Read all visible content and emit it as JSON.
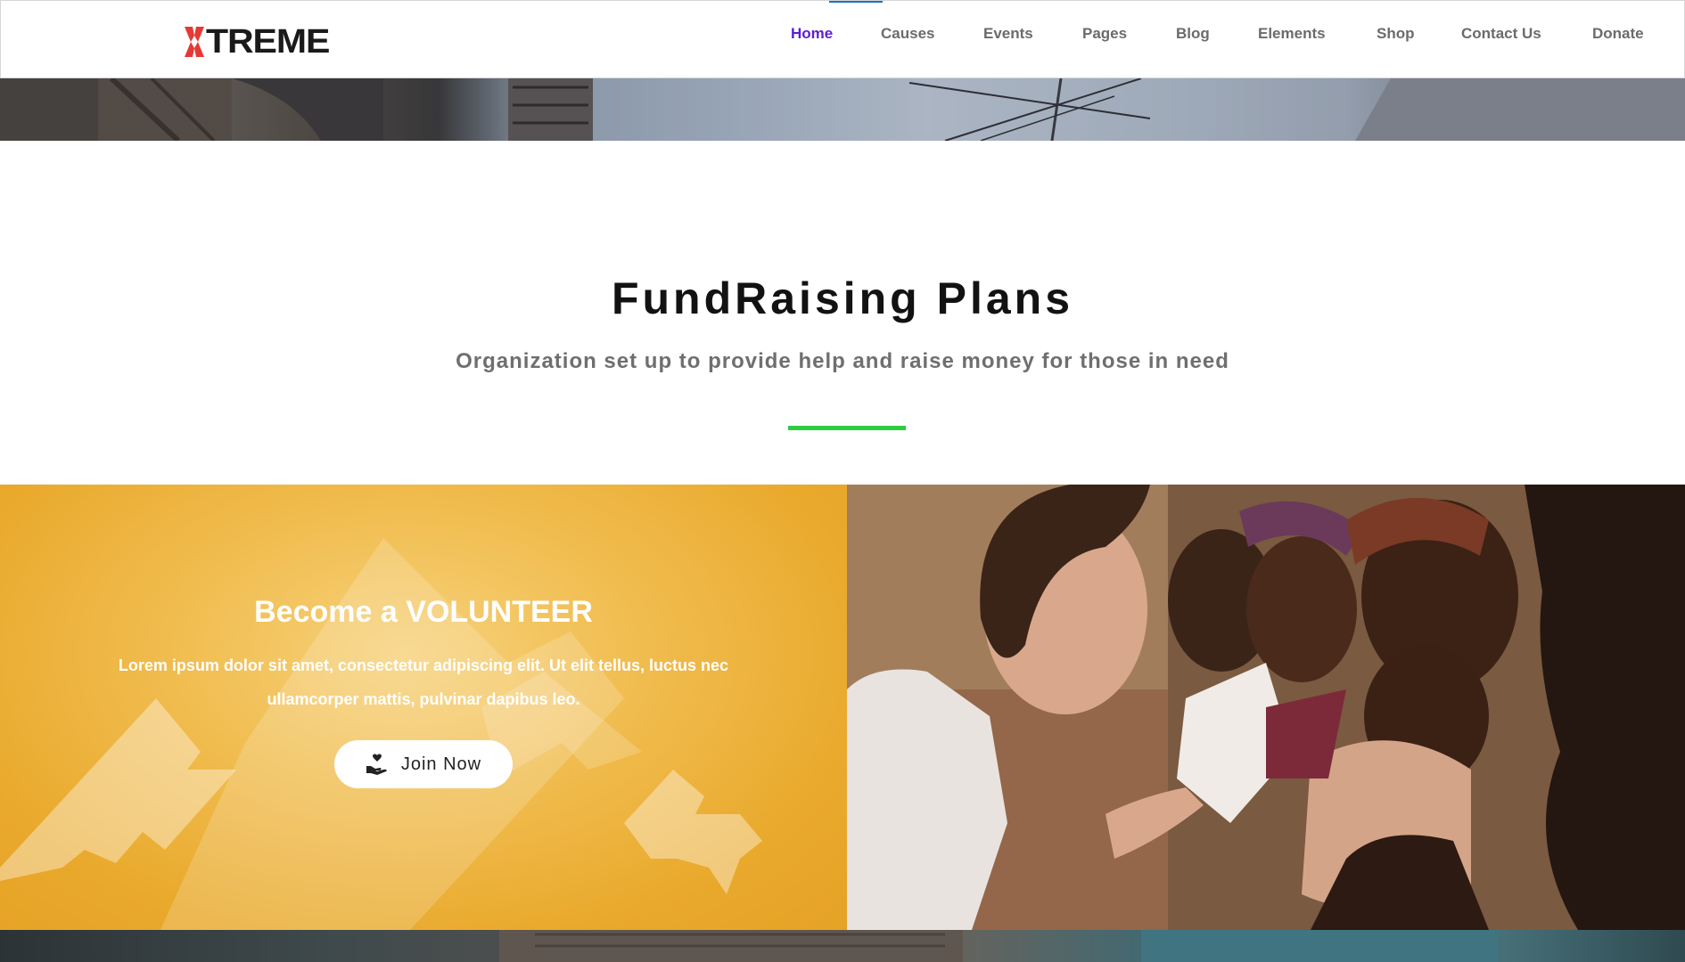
{
  "brand": {
    "logo_text": "XTREME",
    "logo_accent": "X",
    "logo_rest": "TREME",
    "accent_color": "#e53935"
  },
  "nav": {
    "items": [
      {
        "label": "Home",
        "active": true
      },
      {
        "label": "Causes",
        "active": false
      },
      {
        "label": "Events",
        "active": false
      },
      {
        "label": "Pages",
        "active": false
      },
      {
        "label": "Blog",
        "active": false
      },
      {
        "label": "Elements",
        "active": false
      },
      {
        "label": "Shop",
        "active": false
      },
      {
        "label": "Contact Us",
        "active": false
      },
      {
        "label": "Donate",
        "active": false
      }
    ],
    "active_color": "#5b1fd0",
    "text_color": "#6b6b6b"
  },
  "section": {
    "title": "FundRaising Plans",
    "subtitle": "Organization set up to provide help and raise money for those in need",
    "divider_color": "#2ecc40"
  },
  "volunteer": {
    "title": "Become a VOLUNTEER",
    "text": "Lorem ipsum dolor sit amet, consectetur adipiscing elit. Ut elit tellus, luctus nec ullamcorper mattis, pulvinar dapibus leo.",
    "button_label": "Join Now",
    "button_icon": "hand-heart-icon",
    "background_color": "#e9a92c"
  },
  "images": {
    "top_strip": "city-street-photo",
    "main_photo": "volunteer-with-children-photo",
    "bottom_strip": "river-dock-photo"
  }
}
